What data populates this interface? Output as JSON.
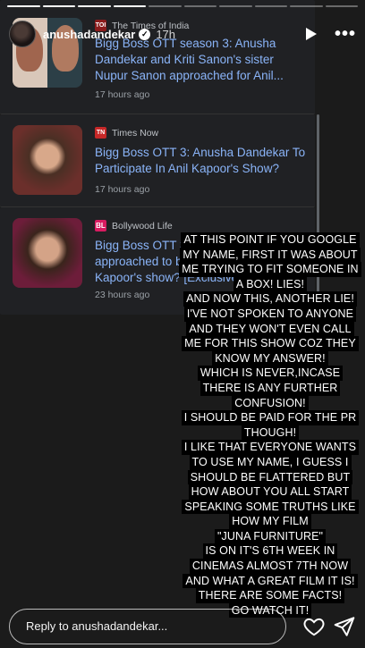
{
  "story": {
    "username": "anushadandekar",
    "verified_glyph": "✓",
    "time": "17h",
    "more_glyph": "•••",
    "progress_segments": 10,
    "progress_done": 4
  },
  "articles": [
    {
      "source": "The Times of India",
      "logo": "TOI",
      "headline": "Bigg Boss OTT season 3: Anusha Dandekar and Kriti Sanon's sister Nupur Sanon approached for Anil...",
      "age": "17 hours ago"
    },
    {
      "source": "Times Now",
      "logo": "TN",
      "headline": "Bigg Boss OTT 3: Anusha Dandekar To Participate In Anil Kapoor's Show?",
      "age": "17 hours ago"
    },
    {
      "source": "Bollywood Life",
      "logo": "BL",
      "headline": "Bigg Boss OTT 3: Anusha Dandekar approached to be a part of Anil Kapoor's show? [Exclusive]",
      "age": "23 hours ago"
    }
  ],
  "overlay_lines": [
    "AT THIS POINT IF YOU GOOGLE",
    "MY NAME, FIRST IT WAS ABOUT",
    "ME TRYING TO FIT SOMEONE IN",
    "A BOX! LIES!",
    "AND NOW THIS, ANOTHER LIE!",
    "I'VE NOT SPOKEN TO ANYONE",
    "AND THEY WON'T EVEN CALL",
    "ME FOR THIS SHOW COZ THEY",
    "KNOW MY ANSWER!",
    "WHICH IS NEVER,INCASE",
    "THERE IS ANY FURTHER",
    "CONFUSION!",
    "I SHOULD BE PAID FOR THE PR",
    "THOUGH!",
    "I LIKE THAT EVERYONE WANTS",
    "TO USE MY NAME, I GUESS I",
    "SHOULD BE FLATTERED BUT",
    "HOW ABOUT YOU ALL START",
    "SPEAKING SOME TRUTHS LIKE",
    "HOW MY FILM",
    "\"JUNA FURNITURE\"",
    "IS ON IT'S 6TH WEEK IN",
    "CINEMAS ALMOST 7TH NOW",
    "AND WHAT A GREAT FILM IT IS!",
    "THERE ARE SOME FACTS!",
    "GO WATCH IT!"
  ],
  "footer": {
    "reply_placeholder": "Reply to anushadandekar..."
  },
  "icons": {
    "play": "play-icon",
    "more": "more-icon",
    "heart": "heart-icon",
    "send": "send-icon"
  }
}
